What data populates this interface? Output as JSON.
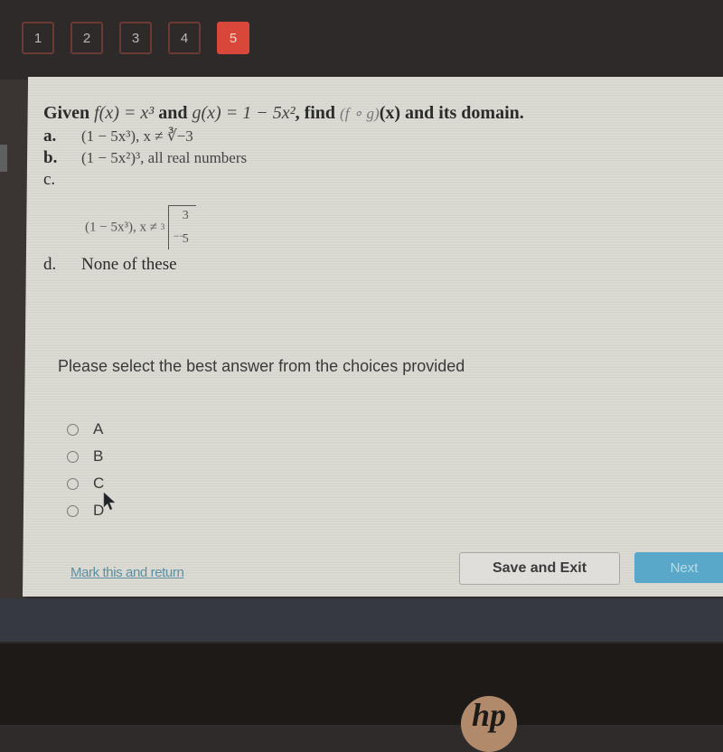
{
  "nav": {
    "questions": [
      {
        "label": "1",
        "active": false
      },
      {
        "label": "2",
        "active": false
      },
      {
        "label": "3",
        "active": false
      },
      {
        "label": "4",
        "active": false
      },
      {
        "label": "5",
        "active": true
      }
    ],
    "active_color": "#d9473a"
  },
  "question": {
    "stem_given": "Given ",
    "stem_f": "f(x) = x³",
    "stem_and": " and ",
    "stem_g": "g(x) = 1 − 5x²",
    "stem_find": ", find ",
    "stem_fog": "(f ∘ g)",
    "stem_x": "(x)",
    "stem_end": " and its domain.",
    "choices": [
      {
        "letter": "a.",
        "expr": "(1 − 5x³), x ≠ ∛−3"
      },
      {
        "letter": "b.",
        "expr": "(1 − 5x²)³, all real numbers"
      },
      {
        "letter": "c.",
        "expr": "(1 − 5x³), x ≠",
        "root_index": "3",
        "num": "3",
        "bar": "−−",
        "den": "5"
      },
      {
        "letter": "d.",
        "expr": "None of these"
      }
    ]
  },
  "instruction": "Please select the best answer from the choices provided",
  "options": [
    "A",
    "B",
    "C",
    "D"
  ],
  "footer": {
    "mark_link": "Mark this and return",
    "save_button": "Save and Exit",
    "next_button": "Next"
  },
  "colors": {
    "next_button": "#5aa8c9",
    "link": "#5d8fa0"
  },
  "device": {
    "logo": "hp"
  }
}
